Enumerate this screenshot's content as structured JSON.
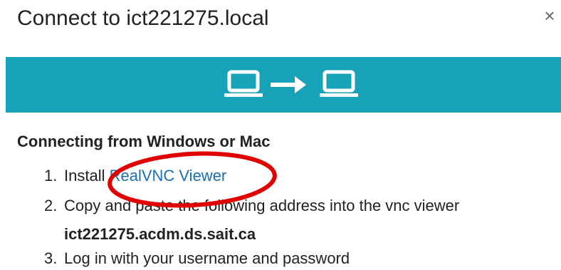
{
  "dialog": {
    "title": "Connect to ict221275.local",
    "close_symbol": "×"
  },
  "banner": {
    "color": "#18a2b8",
    "icons": [
      "laptop-icon",
      "arrow-right-icon",
      "laptop-icon"
    ]
  },
  "instructions": {
    "heading": "Connecting from Windows or Mac",
    "steps": [
      {
        "num": "1.",
        "text": "Install ",
        "link": "RealVNC Viewer"
      },
      {
        "num": "2.",
        "text": "Copy and paste the following address into the vnc viewer"
      },
      {
        "num": "3.",
        "text": "Log in with your username and password"
      }
    ],
    "address": "ict221275.acdm.ds.sait.ca"
  },
  "annotation": {
    "color": "#e00000",
    "shape": "ellipse"
  }
}
